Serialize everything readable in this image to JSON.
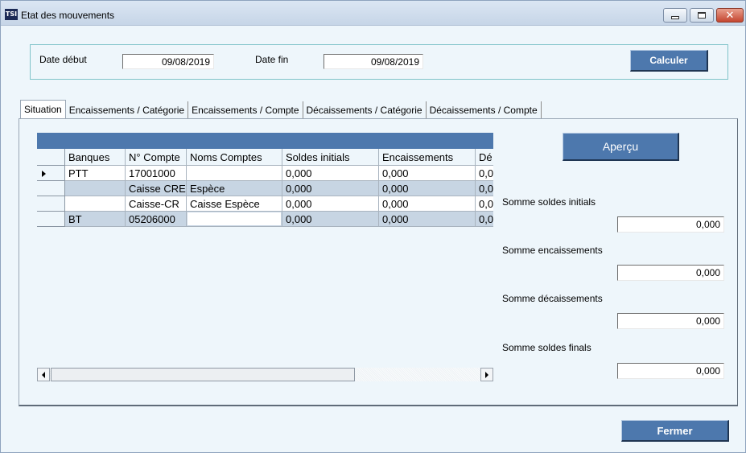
{
  "window": {
    "title": "Etat des mouvements",
    "icon_text": "TSI",
    "close_glyph": "✕"
  },
  "dates": {
    "start_label": "Date début",
    "start_value": "09/08/2019",
    "end_label": "Date fin",
    "end_value": "09/08/2019",
    "calculate_label": "Calculer"
  },
  "tabs": [
    {
      "label": "Situation",
      "active": true
    },
    {
      "label": "Encaissements / Catégorie",
      "active": false
    },
    {
      "label": "Encaissements / Compte",
      "active": false
    },
    {
      "label": "Décaissements / Catégorie",
      "active": false
    },
    {
      "label": "Décaissements / Compte",
      "active": false
    }
  ],
  "grid": {
    "columns": [
      "Banques",
      "N° Compte",
      "Noms Comptes",
      "Soldes initials",
      "Encaissements",
      "Dé"
    ],
    "rows": [
      {
        "banque": "PTT",
        "compte": "17001000",
        "nom": "",
        "solde": "0,000",
        "enc": "0,000",
        "dec": "0,0"
      },
      {
        "banque": "",
        "compte": "Caisse CRE",
        "nom": "Espèce",
        "solde": "0,000",
        "enc": "0,000",
        "dec": "0,0"
      },
      {
        "banque": "",
        "compte": "Caisse-CR",
        "nom": "Caisse Espèce",
        "solde": "0,000",
        "enc": "0,000",
        "dec": "0,0"
      },
      {
        "banque": "BT",
        "compte": "05206000",
        "nom": "",
        "solde": "0,000",
        "enc": "0,000",
        "dec": "0,0"
      }
    ]
  },
  "preview_label": "Aperçu",
  "totals": {
    "initial_label": "Somme soldes initials",
    "initial_value": "0,000",
    "receipts_label": "Somme encaissements",
    "receipts_value": "0,000",
    "payments_label": "Somme décaissements",
    "payments_value": "0,000",
    "final_label": "Somme soldes finals",
    "final_value": "0,000"
  },
  "close_label": "Fermer",
  "colors": {
    "button_blue": "#4d78ad",
    "row_alt": "#c7d5e3",
    "background": "#eef6fb"
  }
}
